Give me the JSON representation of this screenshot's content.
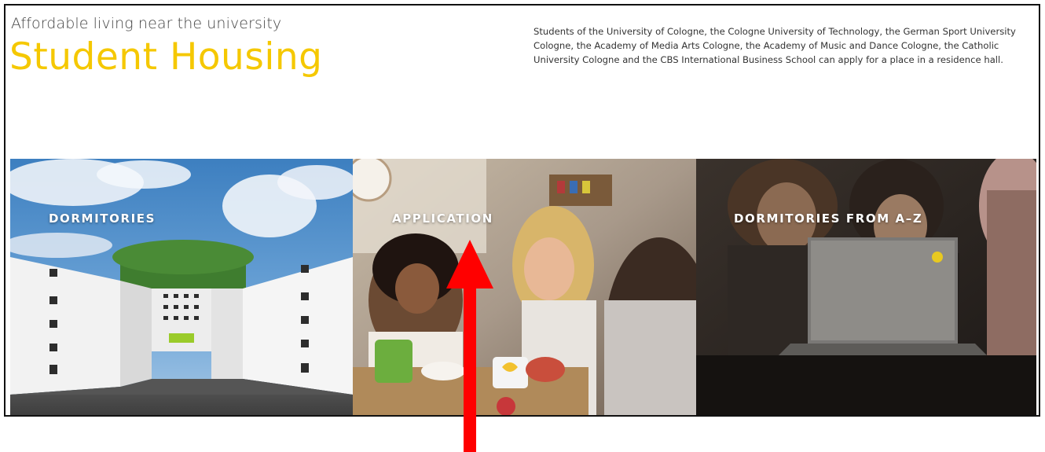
{
  "header": {
    "tagline": "Affordable living near the university",
    "title": "Student Housing",
    "intro": "Students of the University of Cologne, the Cologne University of Technology, the German Sport University Cologne, the Academy of Media Arts Cologne, the Academy of Music and Dance Cologne, the Catholic University Cologne and the CBS International Business School can apply for a place in a residence hall."
  },
  "tiles": [
    {
      "label": "DORMITORIES",
      "image": "dormitory-building-photo"
    },
    {
      "label": "APPLICATION",
      "image": "students-laughing-kitchen-photo"
    },
    {
      "label": "DORMITORIES FROM A–Z",
      "image": "students-laptop-photo"
    }
  ],
  "colors": {
    "brand_yellow": "#f5c800",
    "annotation_arrow": "#ff0000"
  },
  "annotation": {
    "icon": "up-arrow-icon"
  }
}
